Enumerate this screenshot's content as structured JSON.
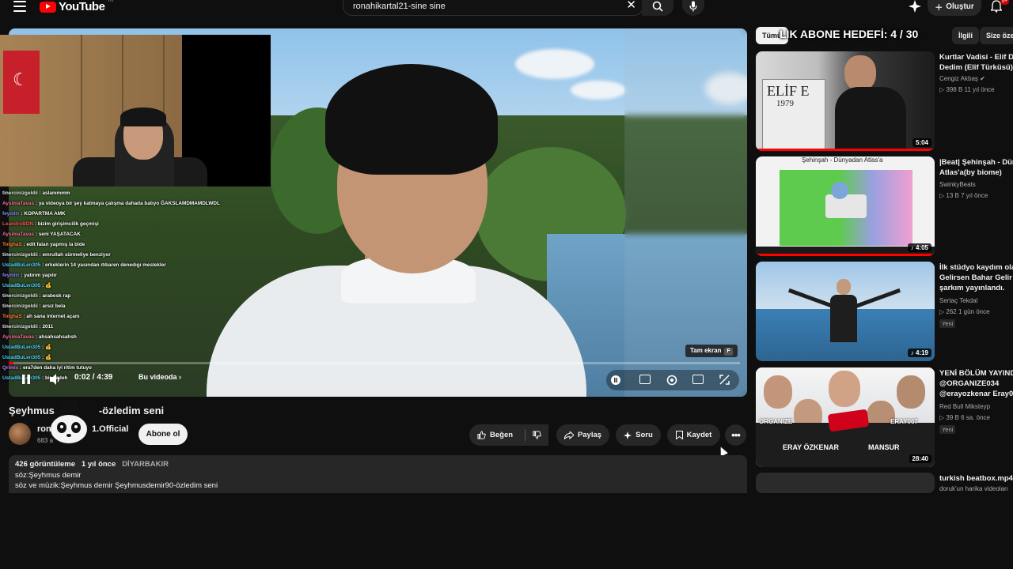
{
  "header": {
    "logo_text": "YouTube",
    "logo_region": "TR",
    "search_value": "ronahikartal21-sine sine",
    "create_label": "Oluştur",
    "notification_count": "9+"
  },
  "stream_overlay": {
    "goal_text": "LIK ABONE HEDEFİ: 4 / 30",
    "chat": [
      {
        "user": "tinercinizgeldii",
        "msg": "aslanımmm",
        "color": "#e6e6e6"
      },
      {
        "user": "AysimaTavas",
        "msg": "ya videoya bir şey katmaya çalışma dahada batıyo ĞAKSLAMDMAMDLWDL",
        "color": "#ff6b9d"
      },
      {
        "user": "feymlrr",
        "msg": "KOPARTMA AMK",
        "color": "#8a8aff"
      },
      {
        "user": "LeandroBDN",
        "msg": "bizim girişimcilik geçmişi",
        "color": "#ff5555"
      },
      {
        "user": "AysimaTavas",
        "msg": "seni YAŞATACAK",
        "color": "#ff6b9d"
      },
      {
        "user": "TolghaS",
        "msg": "edit falan yapmış la bide",
        "color": "#ff7a3d"
      },
      {
        "user": "tinercinizgeldii",
        "msg": "emrullah sürmeliye benziyor",
        "color": "#e6e6e6"
      },
      {
        "user": "UstadBuLen305",
        "msg": "erkeklerin 14 yasından ıtıbaren denedıgı meslekler",
        "color": "#4fd6ff"
      },
      {
        "user": "feymlrr",
        "msg": "yatırım yapılır",
        "color": "#8a8aff"
      },
      {
        "user": "UstadBuLen305",
        "msg": "💰",
        "color": "#4fd6ff"
      },
      {
        "user": "tinercinizgeldii",
        "msg": "arabesk rap",
        "color": "#e6e6e6"
      },
      {
        "user": "tinercinizgeldii",
        "msg": "arsız bela",
        "color": "#e6e6e6"
      },
      {
        "user": "TolghaS",
        "msg": "ah sana internet açanı",
        "color": "#ff7a3d"
      },
      {
        "user": "tinercinizgeldii",
        "msg": "2011",
        "color": "#e6e6e6"
      },
      {
        "user": "AysimaTavas",
        "msg": "ahsahsahsahsh",
        "color": "#ff6b9d"
      },
      {
        "user": "UstadBuLen305",
        "msg": "💰",
        "color": "#4fd6ff"
      },
      {
        "user": "UstadBuLen305",
        "msg": "💰",
        "color": "#4fd6ff"
      },
      {
        "user": "Qrimix",
        "msg": "era7den daha iyi ritim tutuyo",
        "color": "#c67bff"
      },
      {
        "user": "UstadBuLen305",
        "msg": "bir kadeh",
        "color": "#4fd6ff"
      }
    ]
  },
  "player": {
    "time": "0:02 / 4:39",
    "chapter_label": "Bu videoda",
    "tooltip_label": "Tam ekran",
    "tooltip_key": "F",
    "progress_fraction": 0.007
  },
  "video": {
    "title_left": "Şeyhmus",
    "title_right": "-özledim seni",
    "channel_name_left": "ron",
    "channel_name_right": "1.Official",
    "subscribers": "683 a",
    "subscribe_label": "Abone ol",
    "like_label": "Beğen",
    "share_label": "Paylaş",
    "ask_label": "Soru",
    "save_label": "Kaydet"
  },
  "description": {
    "views": "426 görüntüleme",
    "age": "1 yıl önce",
    "location": "DİYARBAKIR",
    "line1": "söz:Şeyhmus demir",
    "line2": "söz ve müzik:Şeyhmus demir Şeyhmusdemir90-özledim seni"
  },
  "sidebar": {
    "chips": [
      {
        "label": "Tümü",
        "active": true
      },
      {
        "label": "İlgili",
        "active": false
      },
      {
        "label": "Size öze",
        "active": false
      }
    ],
    "recommendations": [
      {
        "title1": "Kurtlar Vadisi - Elif De",
        "title2": "Dedim  (Elif Türküsü)",
        "channel": "Cengiz Akbaş",
        "verified": true,
        "stats": "398 B  11 yıl önce",
        "duration": "5:04",
        "watched": true,
        "is_new": false,
        "badge": ""
      },
      {
        "title1": "|Beat| Şehinşah - Dün",
        "title2": "Atlas'a(by biome)",
        "channel": "SwinkyBeats",
        "verified": false,
        "stats": "13 B  7 yıl önce",
        "duration": "4:05",
        "watched": true,
        "is_new": false,
        "badge": ""
      },
      {
        "title1": "İlk stüdyo kaydım ola",
        "title2": "Gelirsen Bahar Gelir ",
        "title3": "şarkım yayınlandı.",
        "channel": "Sertaç Tekdal",
        "verified": false,
        "stats": "262  1 gün önce",
        "duration": "4:19",
        "watched": false,
        "is_new": true,
        "badge": "Yeni"
      },
      {
        "title1": "YENİ BÖLÜM YAYIND",
        "title2": "@ORGANIZE034",
        "title3": "@erayozkenar  Eray0",
        "channel": "Red Bull Mikstеyp",
        "verified": false,
        "stats": "39 B  6 sa. önce",
        "duration": "28:40",
        "watched": false,
        "is_new": true,
        "badge": "Yeni"
      },
      {
        "title1": "turkish beatbox.mp4",
        "channel": "doruk'un harika videoları",
        "verified": false,
        "stats": "",
        "duration": "",
        "watched": false,
        "is_new": false,
        "badge": ""
      }
    ],
    "thumb_texts": {
      "elif_sign": "ELİF E",
      "elif_year": "1979",
      "atlas_caption": "Şehinşah - Dünyadan Atlas'a",
      "rb_names": [
        "ORGANIZE",
        "ERAY ÖZKENAR",
        "MANSUR",
        "ERAY067"
      ]
    }
  },
  "colors": {
    "background": "#0f0f0f",
    "accent_red": "#ff0000",
    "pill_bg": "#272727",
    "muted_text": "#aaaaaa"
  }
}
